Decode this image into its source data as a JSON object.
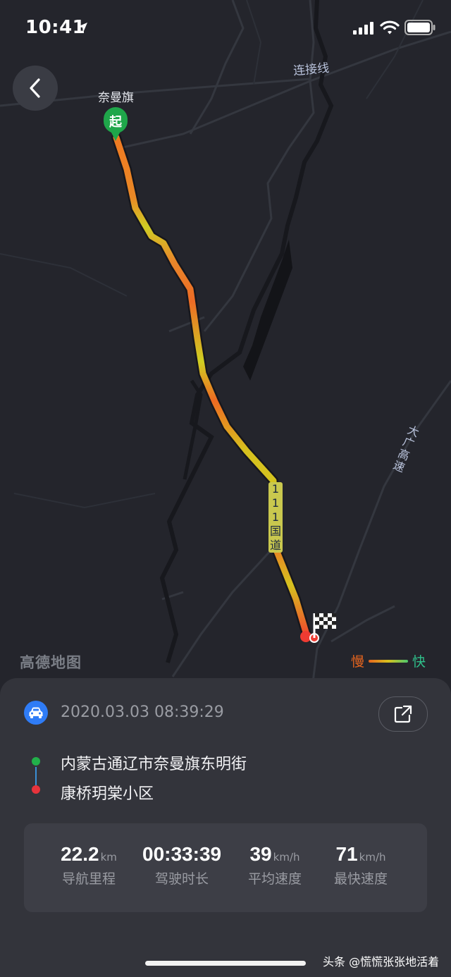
{
  "status_bar": {
    "time": "10:41"
  },
  "map": {
    "start_label": "奈曼旗",
    "start_marker": "起",
    "road_lianjiexian": "连接线",
    "road_daguang": "大广高速",
    "road_111": "111国道",
    "logo": "高德地图",
    "legend": {
      "slow": "慢",
      "fast": "快",
      "slow_color": "#e8651e",
      "fast_color": "#2fbf8a"
    },
    "icons": [
      "location-arrow-icon",
      "signal-icon",
      "wifi-icon",
      "battery-icon",
      "chevron-left-icon",
      "checkered-flag-icon"
    ]
  },
  "trip": {
    "datetime": "2020.03.03 08:39:29",
    "origin": "内蒙古通辽市奈曼旗东明街",
    "destination": "康桥玥棠小区",
    "origin_color": "#22b04a",
    "destination_color": "#e8333c",
    "accent_color": "#2f7cf6"
  },
  "stats": [
    {
      "value": "22.2",
      "unit": "km",
      "label": "导航里程"
    },
    {
      "value": "00:33:39",
      "unit": "",
      "label": "驾驶时长"
    },
    {
      "value": "39",
      "unit": "km/h",
      "label": "平均速度"
    },
    {
      "value": "71",
      "unit": "km/h",
      "label": "最快速度"
    }
  ],
  "watermark": "头条 @慌慌张张地活着"
}
